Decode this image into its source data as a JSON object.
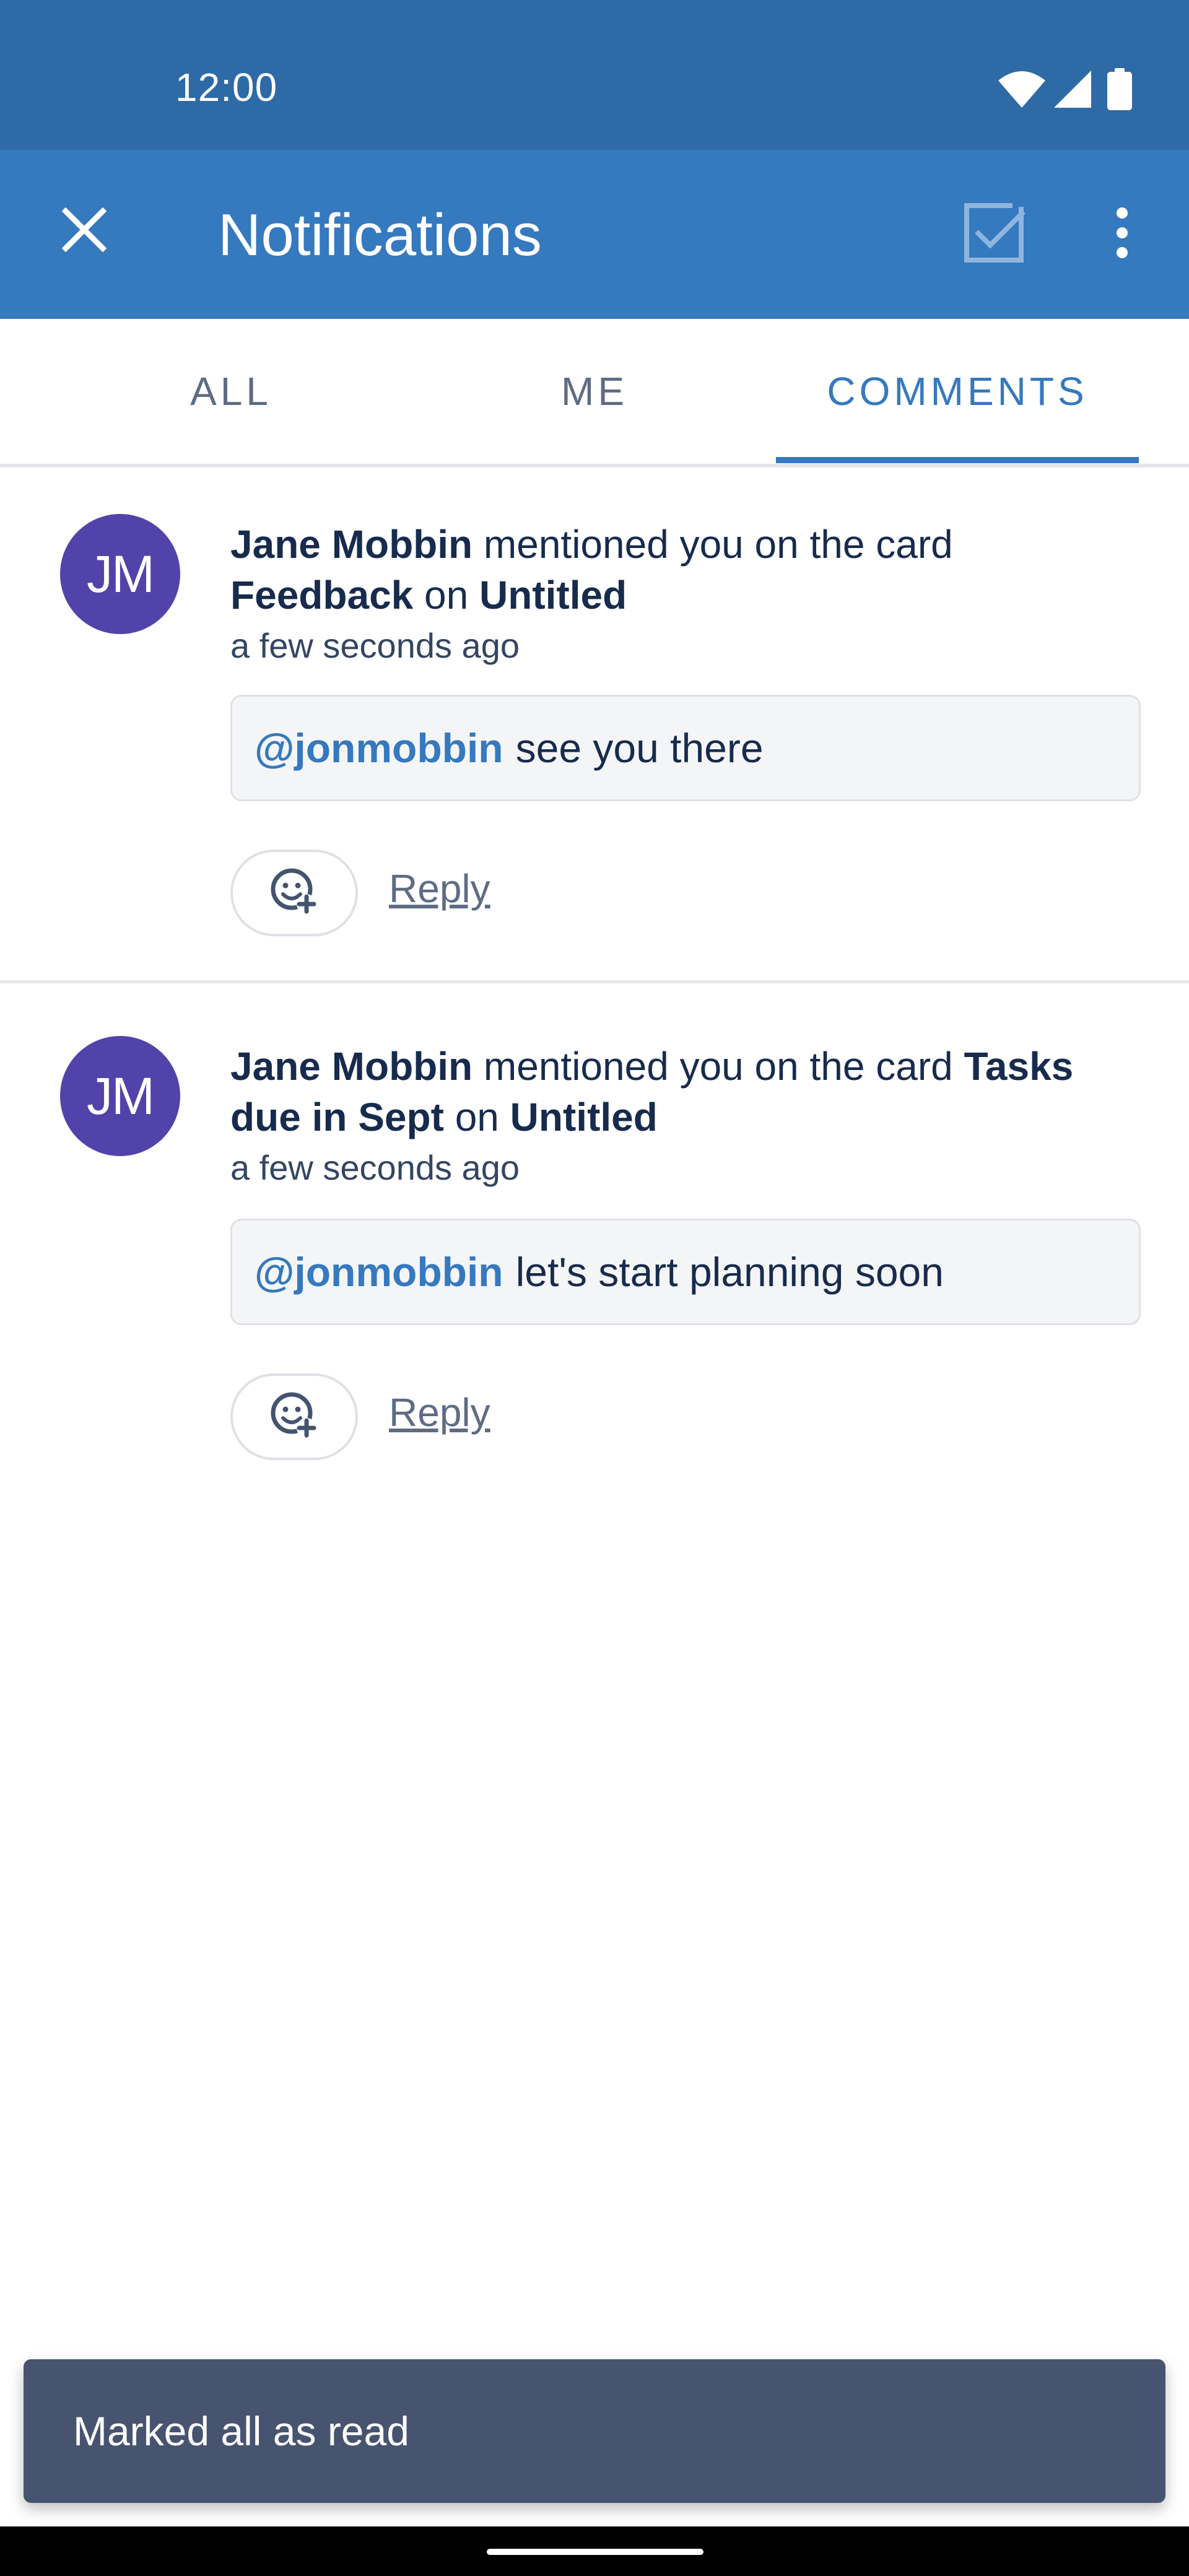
{
  "status_bar": {
    "time": "12:00",
    "icons": [
      "wifi-icon",
      "signal-icon",
      "battery-icon"
    ]
  },
  "app_bar": {
    "title": "Notifications",
    "close_icon": "close-icon",
    "mark_read_icon": "checkbox-icon",
    "more_icon": "more-vert-icon",
    "background": "#3579be"
  },
  "tabs": [
    {
      "label": "ALL",
      "selected": false
    },
    {
      "label": "ME",
      "selected": false
    },
    {
      "label": "COMMENTS",
      "selected": true
    }
  ],
  "notifications": [
    {
      "avatar_initials": "JM",
      "author": "Jane Mobbin",
      "action_text": "mentioned you on the card",
      "card": "Feedback",
      "on_text": "on",
      "board": "Untitled",
      "time": "a few seconds ago",
      "mention": "@jonmobbin",
      "comment": "see you there",
      "reply_label": "Reply"
    },
    {
      "avatar_initials": "JM",
      "author": "Jane Mobbin",
      "action_text": "mentioned you on the card",
      "card": "Tasks due in Sept",
      "on_text": "on",
      "board": "Untitled",
      "time": "a few seconds ago",
      "mention": "@jonmobbin",
      "comment": "let's start planning soon",
      "reply_label": "Reply"
    }
  ],
  "snackbar": {
    "message": "Marked all as read"
  },
  "colors": {
    "status_bar": "#2e6aa5",
    "accent": "#3579be",
    "avatar": "#5243aa",
    "snackbar": "#475470"
  }
}
